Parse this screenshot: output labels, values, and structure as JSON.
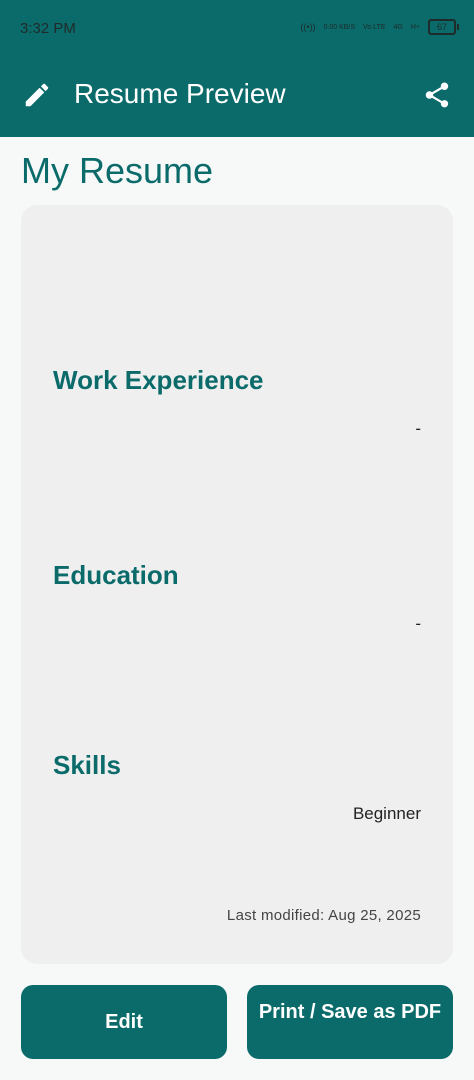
{
  "status_bar": {
    "time": "3:32 PM",
    "speed": "0.00 KB/S",
    "net1": "Vo LTE",
    "net2": "4G",
    "net3": "H+",
    "battery": "67"
  },
  "app_bar": {
    "title": "Resume Preview",
    "left_icon": "pencil-icon",
    "right_icon": "share-icon"
  },
  "main": {
    "heading": "My Resume",
    "sections": [
      {
        "title": "Work Experience",
        "value": "-"
      },
      {
        "title": "Education",
        "value": "-"
      },
      {
        "title": "Skills",
        "value": "Beginner"
      }
    ],
    "last_modified": "Last modified: Aug 25, 2025"
  },
  "buttons": {
    "edit_label": "Edit",
    "print_label": "Print / Save as PDF"
  },
  "colors": {
    "primary": "#0b6b6a",
    "card": "#efefef"
  }
}
